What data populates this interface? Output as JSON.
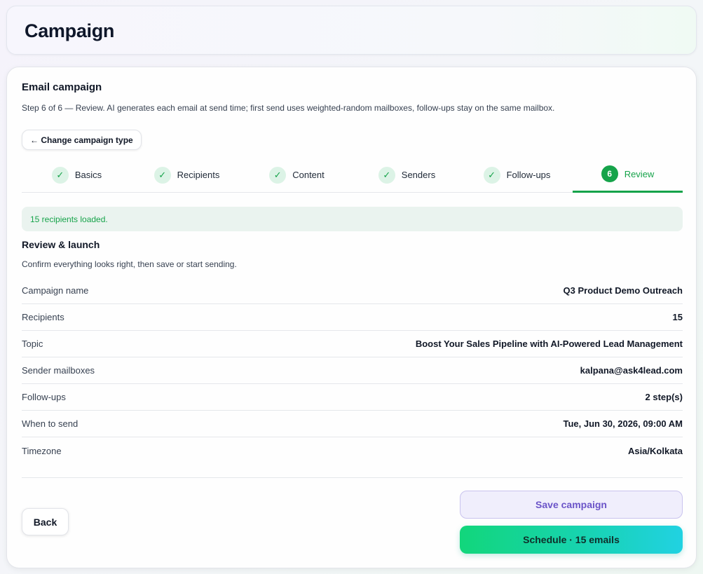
{
  "header": {
    "title": "Campaign"
  },
  "campaign": {
    "title": "Email campaign",
    "subtitle": "Step 6 of 6 — Review. AI generates each email at send time; first send uses weighted-random mailboxes, follow-ups stay on the same mailbox.",
    "change_type_label": "← Change campaign type"
  },
  "steps": [
    {
      "label": "Basics",
      "badge": "✓",
      "state": "done"
    },
    {
      "label": "Recipients",
      "badge": "✓",
      "state": "done"
    },
    {
      "label": "Content",
      "badge": "✓",
      "state": "done"
    },
    {
      "label": "Senders",
      "badge": "✓",
      "state": "done"
    },
    {
      "label": "Follow-ups",
      "badge": "✓",
      "state": "done"
    },
    {
      "label": "Review",
      "badge": "6",
      "state": "active"
    }
  ],
  "alert": {
    "text": "15 recipients loaded."
  },
  "review": {
    "title": "Review & launch",
    "subtitle": "Confirm everything looks right, then save or start sending.",
    "rows": [
      {
        "key": "Campaign name",
        "value": "Q3 Product Demo Outreach"
      },
      {
        "key": "Recipients",
        "value": "15"
      },
      {
        "key": "Topic",
        "value": "Boost Your Sales Pipeline with AI-Powered Lead Management"
      },
      {
        "key": "Sender mailboxes",
        "value": "kalpana@ask4lead.com"
      },
      {
        "key": "Follow-ups",
        "value": "2 step(s)"
      },
      {
        "key": "When to send",
        "value": "Tue, Jun 30, 2026, 09:00 AM"
      },
      {
        "key": "Timezone",
        "value": "Asia/Kolkata"
      }
    ]
  },
  "actions": {
    "back_label": "Back",
    "save_label": "Save campaign",
    "schedule_label": "Schedule · 15 emails"
  },
  "colors": {
    "accent_green": "#16a34a",
    "save_purple": "#6b54c8",
    "schedule_gradient_start": "#12d67b",
    "schedule_gradient_end": "#21d2e2"
  }
}
